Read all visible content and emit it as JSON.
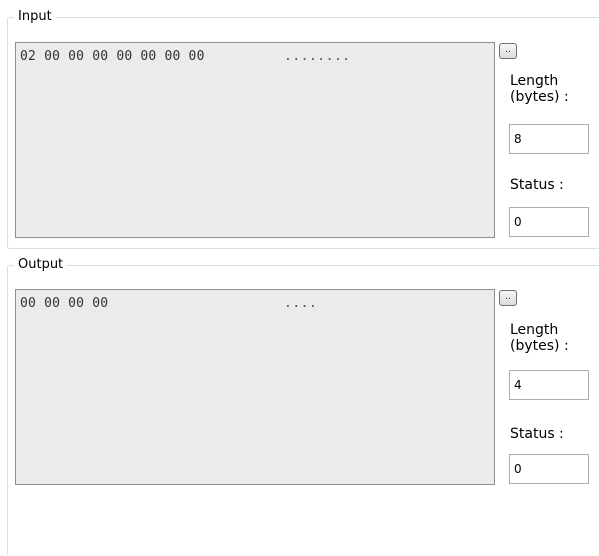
{
  "input": {
    "legend": "Input",
    "hex_bytes": "02 00 00 00 00 00 00 00",
    "hex_ascii": "........",
    "browse_label": "..",
    "length_label_line1": "Length",
    "length_label_line2": "(bytes) :",
    "length_value": "8",
    "status_label": "Status :",
    "status_value": "0"
  },
  "output": {
    "legend": "Output",
    "hex_bytes": "00 00 00 00",
    "hex_ascii": "....",
    "browse_label": "..",
    "length_label_line1": "Length",
    "length_label_line2": "(bytes) :",
    "length_value": "4",
    "status_label": "Status :",
    "status_value": "0"
  }
}
